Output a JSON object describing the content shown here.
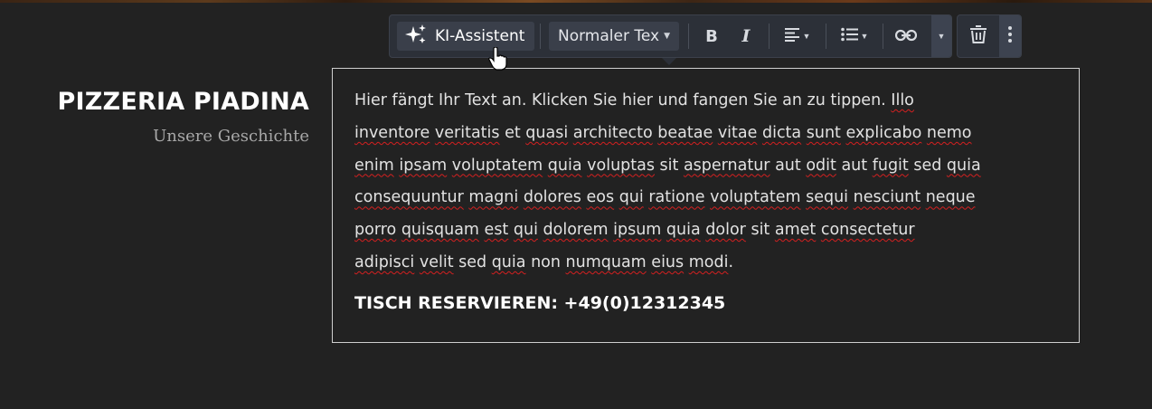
{
  "brand": {
    "title": "PIZZERIA PIADINA",
    "subtitle": "Unsere Geschichte"
  },
  "toolbar": {
    "ai_label": "KI-Assistent",
    "style_value": "Normaler Text",
    "icons": [
      "sparkle-icon",
      "bold-icon",
      "italic-icon",
      "align-icon",
      "list-icon",
      "link-icon",
      "more-dropdown-icon",
      "trash-icon",
      "kebab-icon"
    ]
  },
  "content": {
    "paragraph_lines": [
      "Hier fängt Ihr Text an. Klicken Sie hier und fangen Sie an zu tippen. Illo",
      "inventore veritatis et quasi architecto beatae vitae dicta sunt explicabo nemo",
      "enim ipsam voluptatem quia voluptas sit aspernatur aut odit aut fugit sed quia",
      "consequuntur magni dolores eos qui ratione voluptatem sequi nesciunt neque",
      "porro quisquam est qui dolorem ipsum quia dolor sit amet consectetur",
      "adipisci velit sed quia non numquam eius modi."
    ],
    "cta": "TISCH RESERVIEREN: +49(0)12312345"
  },
  "colors": {
    "background": "#222222",
    "toolbar": "#2c3038",
    "spellcheck": "#d42020"
  }
}
